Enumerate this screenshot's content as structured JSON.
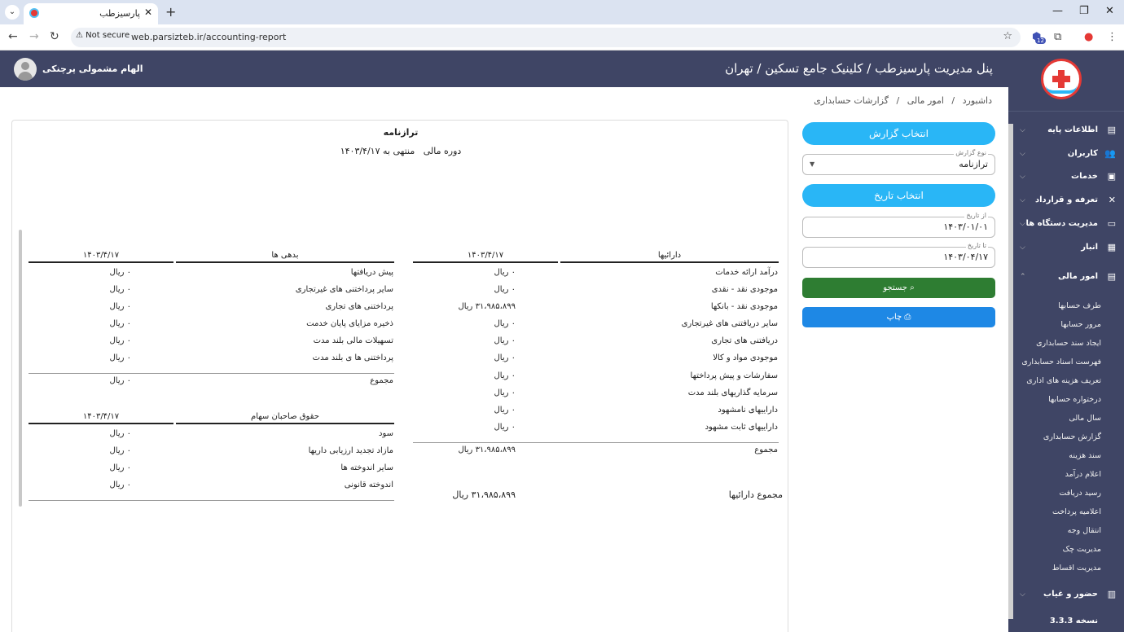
{
  "browser": {
    "tab_title": "پارسیزطب",
    "url_security": "Not secure",
    "url": "web.parsizteb.ir/accounting-report",
    "ext_badge": "12"
  },
  "header": {
    "title": "پنل مدیریت پارسیزطب / کلینیک جامع تسکین / تهران",
    "username": "الهام مشمولی پرچنکی"
  },
  "breadcrumb": [
    "داشبورد",
    "امور مالی",
    "گزارشات حسابداری"
  ],
  "breadcrumb_sep": "/",
  "sidebar": {
    "menu": [
      {
        "label": "اطلاعات پایه",
        "icon": "▤"
      },
      {
        "label": "کاربران",
        "icon": "👥"
      },
      {
        "label": "خدمات",
        "icon": "▣"
      },
      {
        "label": "تعرفه و قرارداد",
        "icon": "✕"
      },
      {
        "label": "مدیریت دستگاه ها",
        "icon": "▭"
      },
      {
        "label": "انبار",
        "icon": "▦"
      },
      {
        "label": "امور مالی",
        "icon": "▤"
      }
    ],
    "finance_subitems": [
      "طرف حسابها",
      "مرور حسابها",
      "ایجاد سند حسابداری",
      "فهرست اسناد حسابداری",
      "تعریف هزینه های اداری",
      "درختواره حسابها",
      "سال مالی",
      "گزارش حسابداری",
      "سند هزینه",
      "اعلام درآمد",
      "رسید دریافت",
      "اعلامیه پرداخت",
      "انتقال وجه",
      "مدیریت چک",
      "مدیریت اقساط"
    ],
    "attendance": {
      "label": "حضور و غیاب",
      "icon": "▥"
    },
    "version": "نسخه 3.3.3"
  },
  "form": {
    "select_report_btn": "انتخاب گزارش",
    "report_type_label": "نوع گزارش",
    "report_type_value": "ترازنامه",
    "select_date_btn": "انتخاب تاریخ",
    "from_label": "از تاریخ",
    "from_value": "۱۴۰۳/۰۱/۰۱",
    "to_label": "تا تاریخ",
    "to_value": "۱۴۰۳/۰۴/۱۷",
    "search_btn": "جستجو",
    "print_btn": "چاپ"
  },
  "report": {
    "title": "ترازنامه",
    "period_label": "دوره مالی",
    "period_value": "منتهی به ۱۴۰۳/۴/۱۷",
    "assets": {
      "header": "دارائیها",
      "date_header": "۱۴۰۳/۴/۱۷",
      "rows": [
        {
          "label": "درآمد ارائه خدمات",
          "value": "۰ ریال"
        },
        {
          "label": "موجودی نقد - نقدی",
          "value": "۰ ریال"
        },
        {
          "label": "موجودی نقد - بانکها",
          "value": "۳۱،۹۸۵،۸۹۹ ریال"
        },
        {
          "label": "سایر دریافتنی های غیرتجاری",
          "value": "۰ ریال"
        },
        {
          "label": "دریافتنی های تجاری",
          "value": "۰ ریال"
        },
        {
          "label": "موجودی مواد و کالا",
          "value": "۰ ریال"
        },
        {
          "label": "سفارشات و پیش پرداختها",
          "value": "۰ ریال"
        },
        {
          "label": "سرمایه گذاریهای بلند مدت",
          "value": "۰ ریال"
        },
        {
          "label": "داراییهای نامشهود",
          "value": "۰ ریال"
        },
        {
          "label": "داراییهای ثابت مشهود",
          "value": "۰ ریال"
        }
      ],
      "total_label": "مجموع",
      "total_value": "۳۱،۹۸۵،۸۹۹ ریال",
      "grand_label": "مجموع دارائیها",
      "grand_value": "۳۱،۹۸۵،۸۹۹ ریال"
    },
    "liabilities": {
      "header": "بدهی ها",
      "date_header": "۱۴۰۳/۴/۱۷",
      "rows": [
        {
          "label": "پیش دریافتها",
          "value": "۰ ریال"
        },
        {
          "label": "سایر پرداختنی های غیرتجاری",
          "value": "۰ ریال"
        },
        {
          "label": "پرداختنی های تجاری",
          "value": "۰ ریال"
        },
        {
          "label": "ذخیره مزایای پایان خدمت",
          "value": "۰ ریال"
        },
        {
          "label": "تسهیلات مالی بلند مدت",
          "value": "۰ ریال"
        },
        {
          "label": "پرداختنی ها ی بلند مدت",
          "value": "۰ ریال"
        }
      ],
      "total_label": "مجموع",
      "total_value": "۰ ریال"
    },
    "equity": {
      "header": "حقوق صاحبان سهام",
      "date_header": "۱۴۰۳/۴/۱۷",
      "rows": [
        {
          "label": "سود",
          "value": "۰ ریال"
        },
        {
          "label": "مازاد تجدید ارزیابی داریها",
          "value": "۰ ریال"
        },
        {
          "label": "سایر اندوخته ها",
          "value": "۰ ریال"
        },
        {
          "label": "اندوخته قانونی",
          "value": "۰ ریال"
        }
      ]
    }
  }
}
